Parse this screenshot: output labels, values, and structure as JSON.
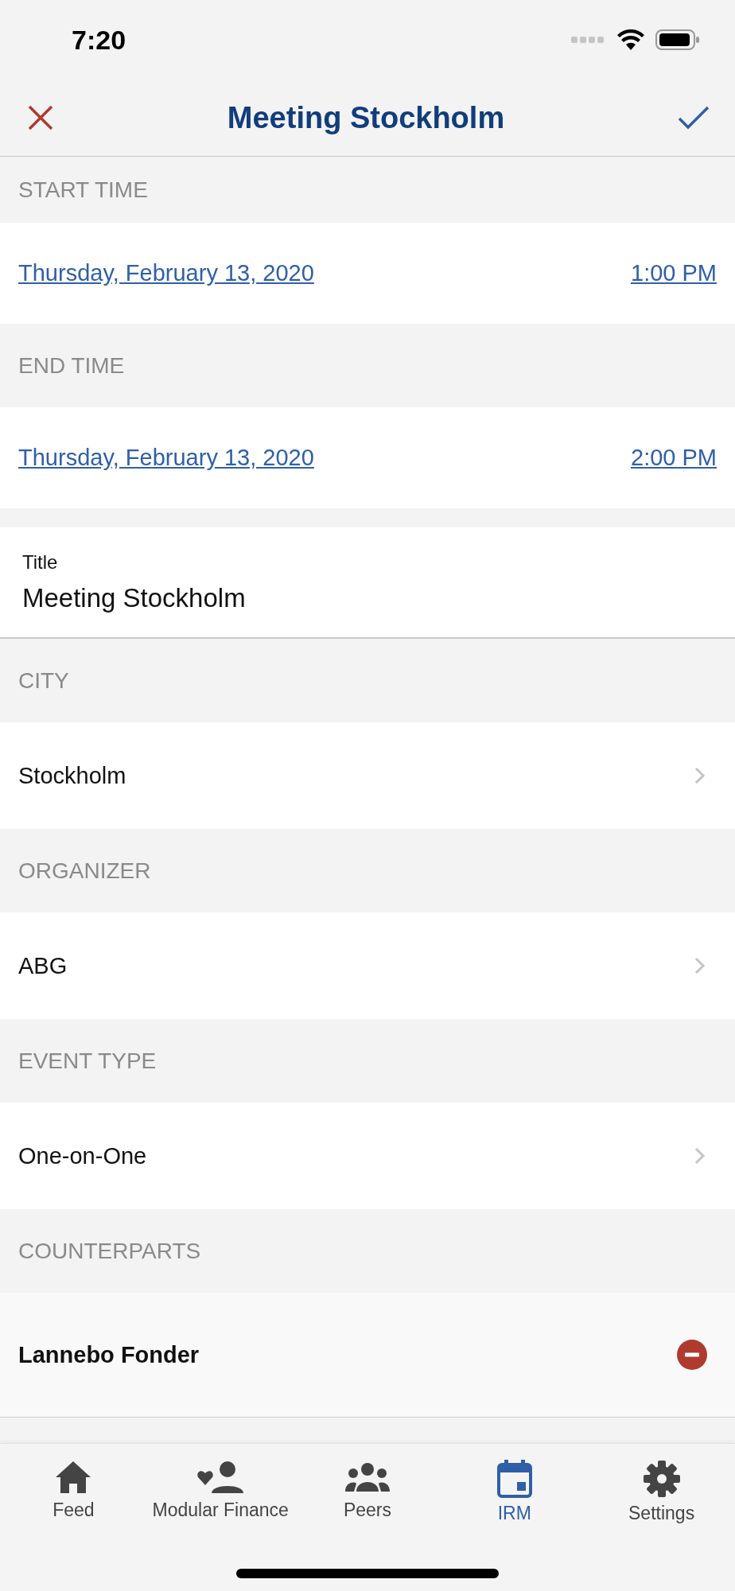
{
  "status_bar": {
    "time": "7:20"
  },
  "nav": {
    "title": "Meeting Stockholm"
  },
  "sections": [
    {
      "kind": "datetime",
      "header": "START TIME",
      "date": "Thursday, February 13, 2020",
      "time": "1:00 PM"
    },
    {
      "kind": "datetime",
      "header": "END TIME",
      "date": "Thursday, February 13, 2020",
      "time": "2:00 PM"
    },
    {
      "kind": "field",
      "label": "Title",
      "value": "Meeting Stockholm"
    },
    {
      "kind": "picker",
      "header": "CITY",
      "value": "Stockholm"
    },
    {
      "kind": "picker",
      "header": "ORGANIZER",
      "value": "ABG"
    },
    {
      "kind": "picker",
      "header": "EVENT TYPE",
      "value": "One-on-One"
    },
    {
      "kind": "list",
      "header": "COUNTERPARTS",
      "items": [
        {
          "name": "Lannebo Fonder"
        }
      ]
    }
  ],
  "tabs": [
    {
      "label": "Feed",
      "selected": false
    },
    {
      "label": "Modular Finance",
      "selected": false
    },
    {
      "label": "Peers",
      "selected": false
    },
    {
      "label": "IRM",
      "selected": true
    },
    {
      "label": "Settings",
      "selected": false
    }
  ]
}
